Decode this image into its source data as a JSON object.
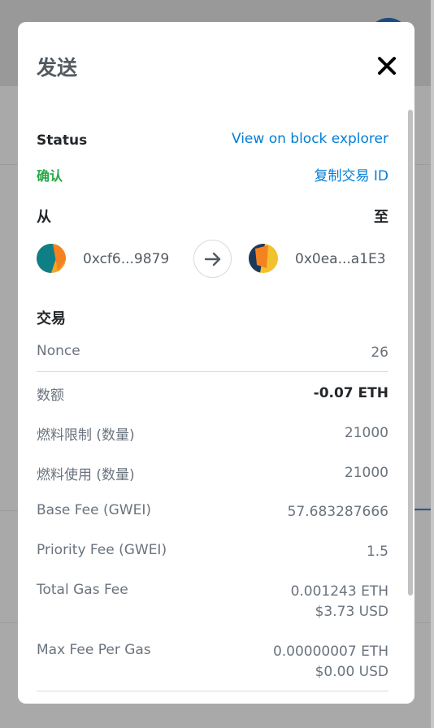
{
  "modal": {
    "title": "发送",
    "status_label": "Status",
    "explorer_link": "View on block explorer",
    "status_value": "确认",
    "copy_tx_id": "复制交易 ID",
    "from_label": "从",
    "to_label": "至",
    "from_address": "0xcf6...9879",
    "to_address": "0x0ea...a1E3",
    "transaction_heading": "交易",
    "details": [
      {
        "label": "Nonce",
        "values": [
          "26"
        ]
      },
      {
        "label": "数额",
        "values": [
          "-0.07 ETH"
        ]
      },
      {
        "label": "燃料限制 (数量)",
        "values": [
          "21000"
        ]
      },
      {
        "label": "燃料使用 (数量)",
        "values": [
          "21000"
        ]
      },
      {
        "label": "Base Fee (GWEI)",
        "values": [
          "57.683287666"
        ]
      },
      {
        "label": "Priority Fee (GWEI)",
        "values": [
          "1.5"
        ]
      },
      {
        "label": "Total Gas Fee",
        "values": [
          "0.001243 ETH",
          "$3.73 USD"
        ]
      },
      {
        "label": "Max Fee Per Gas",
        "values": [
          "0.00000007 ETH",
          "$0.00 USD"
        ]
      }
    ]
  },
  "colors": {
    "link": "#037dd6",
    "confirmed": "#28a745",
    "text": "#24272a",
    "muted": "#6a737d"
  },
  "icons": [
    "close-icon",
    "arrow-right-icon",
    "jazzicon-avatar"
  ]
}
